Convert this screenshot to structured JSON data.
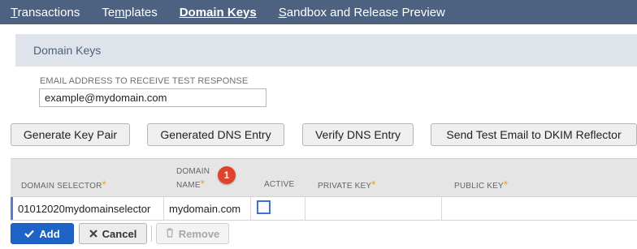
{
  "nav": {
    "transactions": {
      "first": "T",
      "rest": "ransactions"
    },
    "templates": {
      "first": "Te",
      "underline": "m",
      "rest": "plates"
    },
    "domain_keys": {
      "first": "D",
      "rest": "omain Keys"
    },
    "sandbox": {
      "first": "S",
      "rest": "andbox and Release Preview"
    }
  },
  "section": {
    "title": "Domain Keys"
  },
  "email": {
    "label": "EMAIL ADDRESS TO RECEIVE TEST RESPONSE",
    "value": "example@mydomain.com"
  },
  "buttons": {
    "generate_key_pair": "Generate Key Pair",
    "generated_dns_entry": "Generated DNS Entry",
    "verify_dns_entry": "Verify DNS Entry",
    "send_test_email": "Send Test Email to DKIM Reflector"
  },
  "table": {
    "headers": {
      "domain_selector": "DOMAIN SELECTOR",
      "domain_name_line1": "DOMAIN",
      "domain_name_line2": "NAME",
      "active": "ACTIVE",
      "private_key": "PRIVATE KEY",
      "public_key": "PUBLIC KEY",
      "required_mark": "*"
    },
    "badge": "1",
    "rows": [
      {
        "domain_selector": "01012020mydomainselector",
        "domain_name": "mydomain.com",
        "active": false,
        "private_key": "",
        "public_key": ""
      }
    ]
  },
  "actions": {
    "add": "Add",
    "cancel": "Cancel",
    "remove": "Remove"
  },
  "colors": {
    "nav_bg": "#4c6280",
    "section_bg": "#dfe4eb",
    "required": "#e7a00e",
    "badge": "#e0432c",
    "primary": "#1e63c7"
  },
  "icons": {
    "add": "check-icon",
    "cancel": "x-icon",
    "remove": "trash-icon"
  }
}
